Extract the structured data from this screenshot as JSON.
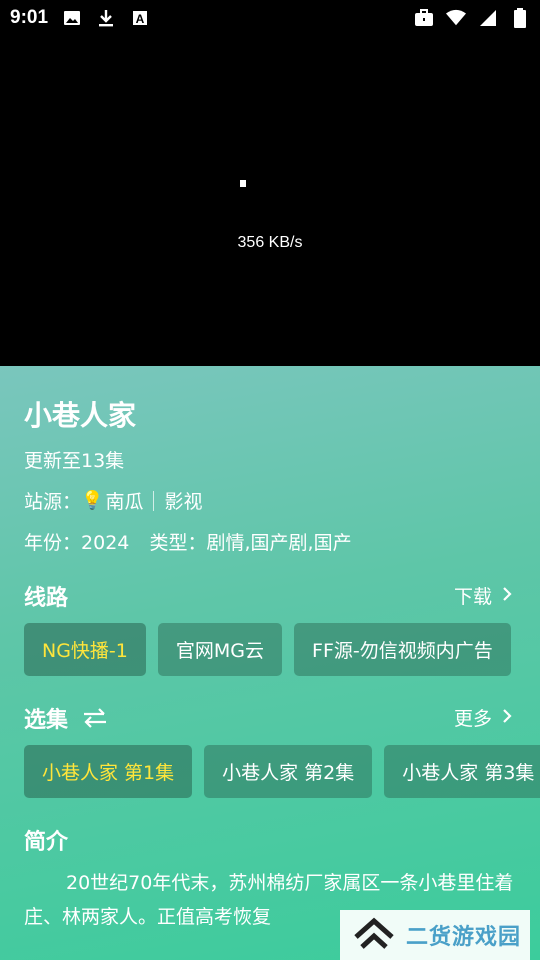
{
  "status_bar": {
    "time": "9:01",
    "left_icons": [
      "image-icon",
      "download-icon",
      "keyboard-a-icon"
    ],
    "right_icons": [
      "briefcase-icon",
      "wifi-icon",
      "signal-icon",
      "battery-icon"
    ]
  },
  "player": {
    "download_speed": "356 KB/s"
  },
  "details": {
    "title": "小巷人家",
    "update_status": "更新至13集",
    "source_label": "站源：",
    "source_name": "南瓜",
    "source_type": "影视",
    "year_label": "年份：",
    "year": "2024",
    "genre_label": "类型：",
    "genre": "剧情,国产剧,国产"
  },
  "routes": {
    "section_title": "线路",
    "download_label": "下载",
    "items": [
      {
        "label": "NG快播-1",
        "active": true
      },
      {
        "label": "官网MG云",
        "active": false
      },
      {
        "label": "FF源-勿信视频内广告",
        "active": false
      }
    ]
  },
  "episodes": {
    "section_title": "选集",
    "more_label": "更多",
    "items": [
      {
        "label": "小巷人家 第1集",
        "active": true
      },
      {
        "label": "小巷人家 第2集",
        "active": false
      },
      {
        "label": "小巷人家 第3集",
        "active": false
      }
    ]
  },
  "intro": {
    "section_title": "简介",
    "text": "20世纪70年代末，苏州棉纺厂家属区一条小巷里住着庄、林两家人。正值高考恢复"
  },
  "watermark": {
    "text": "二货游戏园"
  },
  "colors": {
    "accent_active": "#ffe53b",
    "panel_gradient_start": "#7ac6bd",
    "panel_gradient_end": "#3ccc9c"
  }
}
